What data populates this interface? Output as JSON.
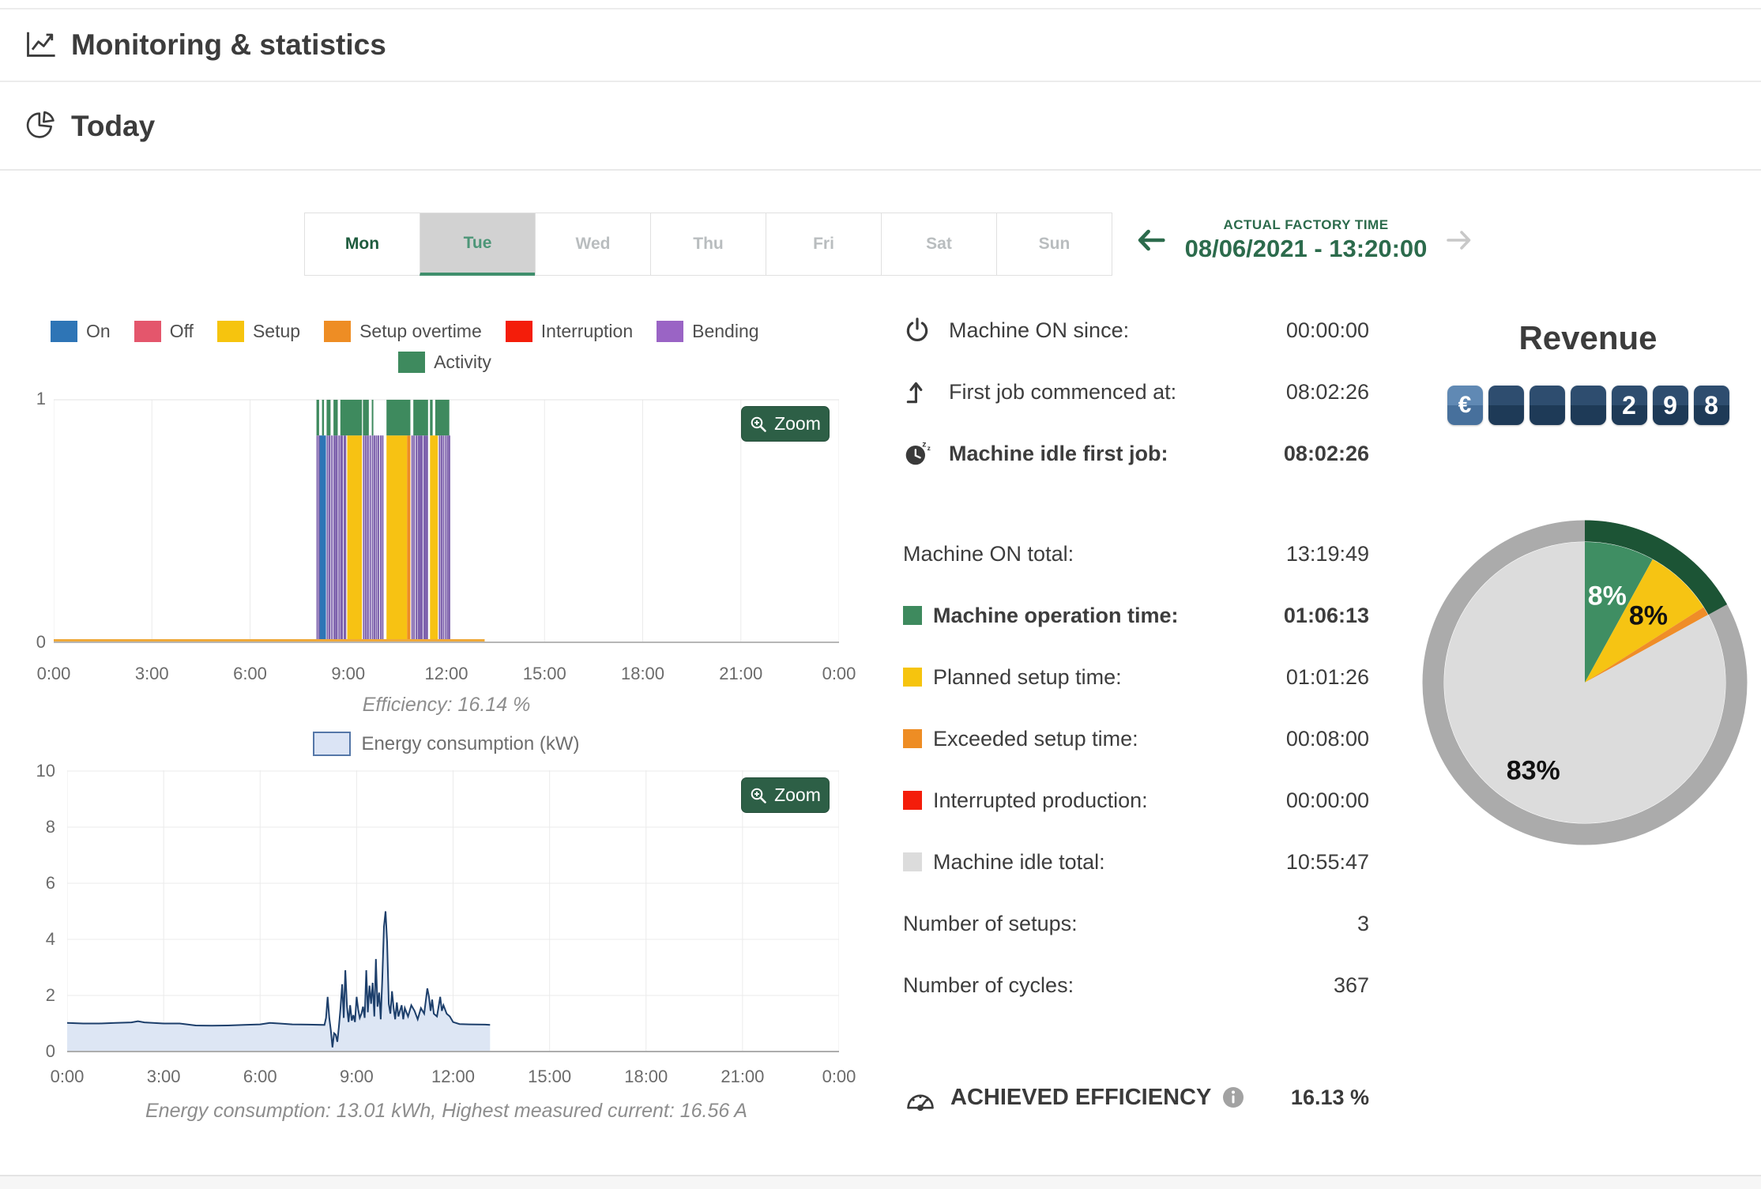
{
  "header": {
    "title": "Monitoring & statistics"
  },
  "section": {
    "title": "Today"
  },
  "tabs": {
    "items": [
      {
        "label": "Mon",
        "state": "past"
      },
      {
        "label": "Tue",
        "state": "selected"
      },
      {
        "label": "Wed",
        "state": "future"
      },
      {
        "label": "Thu",
        "state": "future"
      },
      {
        "label": "Fri",
        "state": "future"
      },
      {
        "label": "Sat",
        "state": "future"
      },
      {
        "label": "Sun",
        "state": "future"
      }
    ]
  },
  "factory_time": {
    "label": "ACTUAL FACTORY TIME",
    "value": "08/06/2021 - 13:20:00"
  },
  "ui": {
    "zoom_button": "Zoom"
  },
  "legend_timeline": {
    "row1": [
      {
        "label": "On",
        "color": "#2e75b6"
      },
      {
        "label": "Off",
        "color": "#e4566c"
      },
      {
        "label": "Setup",
        "color": "#f6c40e"
      },
      {
        "label": "Setup overtime",
        "color": "#ee8d24"
      },
      {
        "label": "Interruption",
        "color": "#f41d0a"
      },
      {
        "label": "Bending",
        "color": "#9a64c5"
      }
    ],
    "row2": [
      {
        "label": "Activity",
        "color": "#3e8a5e"
      }
    ]
  },
  "legend_energy": {
    "label": "Energy consumption (kW)",
    "fill": "#dbe4f5",
    "border": "#5577a8"
  },
  "captions": {
    "efficiency": "Efficiency: 16.14 %",
    "energy": "Energy consumption: 13.01 kWh, Highest measured current: 16.56 A"
  },
  "stats": {
    "rows_top": [
      {
        "icon": "power-icon",
        "label": "Machine ON since:",
        "value": "00:00:00",
        "bold": false
      },
      {
        "icon": "first-job-icon",
        "label": "First job commenced at:",
        "value": "08:02:26",
        "bold": false
      },
      {
        "icon": "idle-clock-icon",
        "label": "Machine idle first job:",
        "value": "08:02:26",
        "bold": true
      }
    ],
    "rows_main": [
      {
        "label": "Machine ON total:",
        "value": "13:19:49",
        "bold": false
      },
      {
        "swatch": "#3e8a5e",
        "label": "Machine operation time:",
        "value": "01:06:13",
        "bold": true
      },
      {
        "swatch": "#f6c40e",
        "label": "Planned setup time:",
        "value": "01:01:26",
        "bold": false
      },
      {
        "swatch": "#ee8d24",
        "label": "Exceeded setup time:",
        "value": "00:08:00",
        "bold": false
      },
      {
        "swatch": "#f41d0a",
        "label": "Interrupted production:",
        "value": "00:00:00",
        "bold": false
      },
      {
        "swatch": "#dcdcdc",
        "label": "Machine idle total:",
        "value": "10:55:47",
        "bold": false
      },
      {
        "label": "Number of setups:",
        "value": "3",
        "bold": false
      },
      {
        "label": "Number of cycles:",
        "value": "367",
        "bold": false
      }
    ],
    "efficiency": {
      "label": "ACHIEVED EFFICIENCY",
      "value": "16.13 %"
    }
  },
  "revenue": {
    "title": "Revenue",
    "tiles": [
      {
        "text": "€",
        "type": "currency"
      },
      {
        "text": "",
        "type": "blank"
      },
      {
        "text": "",
        "type": "blank"
      },
      {
        "text": "",
        "type": "blank"
      },
      {
        "text": "2",
        "type": "digit"
      },
      {
        "text": "9",
        "type": "digit"
      },
      {
        "text": "8",
        "type": "digit"
      }
    ]
  },
  "chart_data": [
    {
      "id": "machine-state-timeline",
      "type": "bar",
      "x_ticks": [
        "0:00",
        "3:00",
        "6:00",
        "9:00",
        "12:00",
        "15:00",
        "18:00",
        "21:00",
        "0:00"
      ],
      "x_range_hours": [
        0,
        24
      ],
      "y_ticks": [
        1,
        0
      ],
      "ylim": [
        0,
        1
      ],
      "band_split": 0.85,
      "caption": "Efficiency: 16.14 %",
      "series_colors": {
        "on": "#2e75b6",
        "off": "#e4566c",
        "setup": "#f7c213",
        "setup_overtime": "#ee8d24",
        "interruption": "#f41d0a",
        "bending": "#7e62ad",
        "activity": "#3e8a5e",
        "baseline": "#efa93a"
      },
      "baseline": {
        "start": 0,
        "end": 13.17
      },
      "segments": [
        {
          "s": 8.03,
          "e": 8.07,
          "c": "bending"
        },
        {
          "s": 8.09,
          "e": 8.11,
          "c": "bending"
        },
        {
          "s": 8.13,
          "e": 8.32,
          "c": "on"
        },
        {
          "s": 8.34,
          "e": 8.37,
          "c": "bending"
        },
        {
          "s": 8.4,
          "e": 8.46,
          "c": "bending"
        },
        {
          "s": 8.48,
          "e": 8.52,
          "c": "bending"
        },
        {
          "s": 8.55,
          "e": 8.57,
          "c": "bending"
        },
        {
          "s": 8.6,
          "e": 8.68,
          "c": "bending"
        },
        {
          "s": 8.7,
          "e": 8.74,
          "c": "bending"
        },
        {
          "s": 8.76,
          "e": 8.84,
          "c": "bending"
        },
        {
          "s": 8.86,
          "e": 8.94,
          "c": "bending"
        },
        {
          "s": 8.97,
          "e": 9.42,
          "c": "setup"
        },
        {
          "s": 9.45,
          "e": 9.49,
          "c": "bending"
        },
        {
          "s": 9.51,
          "e": 9.55,
          "c": "bending"
        },
        {
          "s": 9.57,
          "e": 9.63,
          "c": "bending"
        },
        {
          "s": 9.65,
          "e": 9.69,
          "c": "bending"
        },
        {
          "s": 9.72,
          "e": 9.74,
          "c": "bending"
        },
        {
          "s": 9.78,
          "e": 9.8,
          "c": "bending"
        },
        {
          "s": 9.84,
          "e": 9.86,
          "c": "bending"
        },
        {
          "s": 9.9,
          "e": 9.92,
          "c": "bending"
        },
        {
          "s": 9.97,
          "e": 9.99,
          "c": "bending"
        },
        {
          "s": 10.03,
          "e": 10.05,
          "c": "bending"
        },
        {
          "s": 10.17,
          "e": 10.8,
          "c": "setup"
        },
        {
          "s": 10.8,
          "e": 10.9,
          "c": "setup_overtime"
        },
        {
          "s": 10.93,
          "e": 10.96,
          "c": "bending"
        },
        {
          "s": 10.99,
          "e": 11.02,
          "c": "bending"
        },
        {
          "s": 11.06,
          "e": 11.09,
          "c": "bending"
        },
        {
          "s": 11.12,
          "e": 11.28,
          "c": "bending"
        },
        {
          "s": 11.3,
          "e": 11.44,
          "c": "bending"
        },
        {
          "s": 11.5,
          "e": 11.74,
          "c": "setup"
        },
        {
          "s": 11.77,
          "e": 11.8,
          "c": "bending"
        },
        {
          "s": 11.83,
          "e": 11.86,
          "c": "bending"
        },
        {
          "s": 11.89,
          "e": 11.92,
          "c": "bending"
        },
        {
          "s": 11.96,
          "e": 11.98,
          "c": "bending"
        },
        {
          "s": 12.02,
          "e": 12.04,
          "c": "bending"
        },
        {
          "s": 12.07,
          "e": 12.09,
          "c": "bending"
        }
      ],
      "activity_segments": [
        {
          "s": 8.03,
          "e": 8.11
        },
        {
          "s": 8.2,
          "e": 8.26
        },
        {
          "s": 8.34,
          "e": 8.46
        },
        {
          "s": 8.55,
          "e": 8.68
        },
        {
          "s": 8.76,
          "e": 9.42
        },
        {
          "s": 9.45,
          "e": 9.63
        },
        {
          "s": 9.72,
          "e": 9.74
        },
        {
          "s": 10.17,
          "e": 10.9
        },
        {
          "s": 10.99,
          "e": 11.44
        },
        {
          "s": 11.5,
          "e": 11.58
        },
        {
          "s": 11.66,
          "e": 12.09
        }
      ]
    },
    {
      "id": "energy-consumption",
      "type": "area",
      "legend": "Energy consumption (kW)",
      "caption": "Energy consumption: 13.01 kWh, Highest measured current: 16.56 A",
      "ylim": [
        0,
        10
      ],
      "y_ticks": [
        0,
        2,
        4,
        6,
        8,
        10
      ],
      "x_ticks": [
        "0:00",
        "3:00",
        "6:00",
        "9:00",
        "12:00",
        "15:00",
        "18:00",
        "21:00",
        "0:00"
      ],
      "x_range_hours": [
        0,
        24
      ],
      "line_color": "#1d3f6b",
      "fill_color": "#dde6f4",
      "points": [
        [
          0,
          1.02
        ],
        [
          0.5,
          1.0
        ],
        [
          1,
          1.0
        ],
        [
          1.5,
          1.02
        ],
        [
          2,
          1.04
        ],
        [
          2.2,
          1.08
        ],
        [
          2.4,
          1.04
        ],
        [
          3,
          1.0
        ],
        [
          3.5,
          1.0
        ],
        [
          4,
          0.93
        ],
        [
          4.5,
          0.92
        ],
        [
          5,
          0.93
        ],
        [
          5.5,
          0.95
        ],
        [
          6,
          0.97
        ],
        [
          6.3,
          1.02
        ],
        [
          6.6,
          1.0
        ],
        [
          7,
          0.97
        ],
        [
          7.5,
          0.96
        ],
        [
          8.0,
          0.95
        ],
        [
          8.05,
          1.2
        ],
        [
          8.1,
          1.95
        ],
        [
          8.15,
          1.2
        ],
        [
          8.2,
          0.75
        ],
        [
          8.25,
          0.15
        ],
        [
          8.3,
          0.65
        ],
        [
          8.35,
          0.6
        ],
        [
          8.4,
          0.35
        ],
        [
          8.45,
          0.9
        ],
        [
          8.5,
          1.55
        ],
        [
          8.55,
          2.4
        ],
        [
          8.6,
          1.2
        ],
        [
          8.65,
          2.9
        ],
        [
          8.7,
          1.6
        ],
        [
          8.75,
          1.05
        ],
        [
          8.8,
          1.65
        ],
        [
          8.85,
          1.1
        ],
        [
          8.9,
          1.3
        ],
        [
          8.95,
          1.05
        ],
        [
          9.0,
          1.95
        ],
        [
          9.05,
          1.5
        ],
        [
          9.1,
          1.2
        ],
        [
          9.15,
          1.35
        ],
        [
          9.2,
          1.6
        ],
        [
          9.25,
          1.2
        ],
        [
          9.3,
          2.9
        ],
        [
          9.35,
          1.4
        ],
        [
          9.4,
          2.35
        ],
        [
          9.45,
          1.7
        ],
        [
          9.5,
          2.45
        ],
        [
          9.55,
          1.25
        ],
        [
          9.6,
          3.3
        ],
        [
          9.65,
          1.6
        ],
        [
          9.7,
          2.1
        ],
        [
          9.75,
          1.15
        ],
        [
          9.8,
          2.6
        ],
        [
          9.85,
          4.45
        ],
        [
          9.9,
          5.0
        ],
        [
          9.95,
          3.9
        ],
        [
          10.0,
          1.7
        ],
        [
          10.05,
          1.35
        ],
        [
          10.1,
          2.15
        ],
        [
          10.15,
          1.55
        ],
        [
          10.2,
          1.15
        ],
        [
          10.25,
          1.75
        ],
        [
          10.3,
          1.25
        ],
        [
          10.35,
          1.45
        ],
        [
          10.4,
          1.65
        ],
        [
          10.45,
          1.15
        ],
        [
          10.5,
          1.55
        ],
        [
          10.6,
          1.25
        ],
        [
          10.7,
          1.65
        ],
        [
          10.8,
          1.45
        ],
        [
          10.9,
          1.15
        ],
        [
          11.0,
          1.55
        ],
        [
          11.1,
          1.35
        ],
        [
          11.2,
          2.25
        ],
        [
          11.25,
          1.95
        ],
        [
          11.3,
          1.45
        ],
        [
          11.35,
          1.85
        ],
        [
          11.4,
          1.35
        ],
        [
          11.5,
          1.25
        ],
        [
          11.6,
          1.95
        ],
        [
          11.65,
          1.45
        ],
        [
          11.7,
          1.65
        ],
        [
          11.8,
          1.35
        ],
        [
          11.9,
          1.25
        ],
        [
          12.0,
          1.05
        ],
        [
          12.2,
          0.98
        ],
        [
          12.5,
          0.97
        ],
        [
          13.0,
          0.96
        ],
        [
          13.15,
          0.95
        ]
      ]
    },
    {
      "id": "time-distribution-pie",
      "type": "pie",
      "slices": [
        {
          "label": "8%",
          "value": 8,
          "color": "#3f8e63",
          "label_color": "#ffffff",
          "label_r": 0.64
        },
        {
          "label": "8%",
          "value": 8,
          "color": "#f6c413",
          "label_color": "#111111",
          "label_r": 0.66
        },
        {
          "label": "",
          "value": 1,
          "color": "#ef8d28",
          "label_color": "#111111",
          "label_r": 0
        },
        {
          "label": "83%",
          "value": 83,
          "color": "#dcdcdc",
          "label_color": "#111111",
          "label_r": 0.72
        }
      ],
      "ring_color": "#ababab",
      "ring_highlight": {
        "color": "#1c5435",
        "from_pct": 0,
        "to_pct": 17
      }
    }
  ]
}
